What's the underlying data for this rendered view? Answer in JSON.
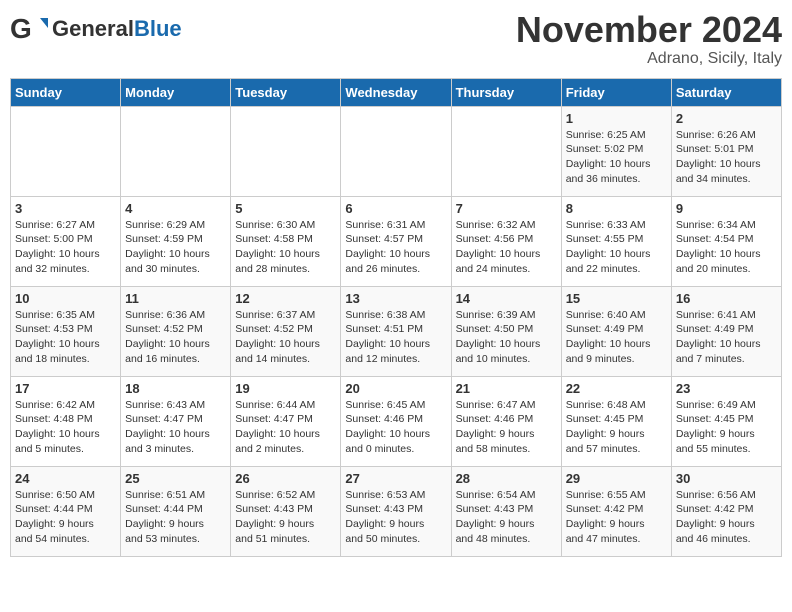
{
  "header": {
    "logo_general": "General",
    "logo_blue": "Blue",
    "month_title": "November 2024",
    "location": "Adrano, Sicily, Italy"
  },
  "weekdays": [
    "Sunday",
    "Monday",
    "Tuesday",
    "Wednesday",
    "Thursday",
    "Friday",
    "Saturday"
  ],
  "weeks": [
    [
      {
        "day": "",
        "info": ""
      },
      {
        "day": "",
        "info": ""
      },
      {
        "day": "",
        "info": ""
      },
      {
        "day": "",
        "info": ""
      },
      {
        "day": "",
        "info": ""
      },
      {
        "day": "1",
        "info": "Sunrise: 6:25 AM\nSunset: 5:02 PM\nDaylight: 10 hours\nand 36 minutes."
      },
      {
        "day": "2",
        "info": "Sunrise: 6:26 AM\nSunset: 5:01 PM\nDaylight: 10 hours\nand 34 minutes."
      }
    ],
    [
      {
        "day": "3",
        "info": "Sunrise: 6:27 AM\nSunset: 5:00 PM\nDaylight: 10 hours\nand 32 minutes."
      },
      {
        "day": "4",
        "info": "Sunrise: 6:29 AM\nSunset: 4:59 PM\nDaylight: 10 hours\nand 30 minutes."
      },
      {
        "day": "5",
        "info": "Sunrise: 6:30 AM\nSunset: 4:58 PM\nDaylight: 10 hours\nand 28 minutes."
      },
      {
        "day": "6",
        "info": "Sunrise: 6:31 AM\nSunset: 4:57 PM\nDaylight: 10 hours\nand 26 minutes."
      },
      {
        "day": "7",
        "info": "Sunrise: 6:32 AM\nSunset: 4:56 PM\nDaylight: 10 hours\nand 24 minutes."
      },
      {
        "day": "8",
        "info": "Sunrise: 6:33 AM\nSunset: 4:55 PM\nDaylight: 10 hours\nand 22 minutes."
      },
      {
        "day": "9",
        "info": "Sunrise: 6:34 AM\nSunset: 4:54 PM\nDaylight: 10 hours\nand 20 minutes."
      }
    ],
    [
      {
        "day": "10",
        "info": "Sunrise: 6:35 AM\nSunset: 4:53 PM\nDaylight: 10 hours\nand 18 minutes."
      },
      {
        "day": "11",
        "info": "Sunrise: 6:36 AM\nSunset: 4:52 PM\nDaylight: 10 hours\nand 16 minutes."
      },
      {
        "day": "12",
        "info": "Sunrise: 6:37 AM\nSunset: 4:52 PM\nDaylight: 10 hours\nand 14 minutes."
      },
      {
        "day": "13",
        "info": "Sunrise: 6:38 AM\nSunset: 4:51 PM\nDaylight: 10 hours\nand 12 minutes."
      },
      {
        "day": "14",
        "info": "Sunrise: 6:39 AM\nSunset: 4:50 PM\nDaylight: 10 hours\nand 10 minutes."
      },
      {
        "day": "15",
        "info": "Sunrise: 6:40 AM\nSunset: 4:49 PM\nDaylight: 10 hours\nand 9 minutes."
      },
      {
        "day": "16",
        "info": "Sunrise: 6:41 AM\nSunset: 4:49 PM\nDaylight: 10 hours\nand 7 minutes."
      }
    ],
    [
      {
        "day": "17",
        "info": "Sunrise: 6:42 AM\nSunset: 4:48 PM\nDaylight: 10 hours\nand 5 minutes."
      },
      {
        "day": "18",
        "info": "Sunrise: 6:43 AM\nSunset: 4:47 PM\nDaylight: 10 hours\nand 3 minutes."
      },
      {
        "day": "19",
        "info": "Sunrise: 6:44 AM\nSunset: 4:47 PM\nDaylight: 10 hours\nand 2 minutes."
      },
      {
        "day": "20",
        "info": "Sunrise: 6:45 AM\nSunset: 4:46 PM\nDaylight: 10 hours\nand 0 minutes."
      },
      {
        "day": "21",
        "info": "Sunrise: 6:47 AM\nSunset: 4:46 PM\nDaylight: 9 hours\nand 58 minutes."
      },
      {
        "day": "22",
        "info": "Sunrise: 6:48 AM\nSunset: 4:45 PM\nDaylight: 9 hours\nand 57 minutes."
      },
      {
        "day": "23",
        "info": "Sunrise: 6:49 AM\nSunset: 4:45 PM\nDaylight: 9 hours\nand 55 minutes."
      }
    ],
    [
      {
        "day": "24",
        "info": "Sunrise: 6:50 AM\nSunset: 4:44 PM\nDaylight: 9 hours\nand 54 minutes."
      },
      {
        "day": "25",
        "info": "Sunrise: 6:51 AM\nSunset: 4:44 PM\nDaylight: 9 hours\nand 53 minutes."
      },
      {
        "day": "26",
        "info": "Sunrise: 6:52 AM\nSunset: 4:43 PM\nDaylight: 9 hours\nand 51 minutes."
      },
      {
        "day": "27",
        "info": "Sunrise: 6:53 AM\nSunset: 4:43 PM\nDaylight: 9 hours\nand 50 minutes."
      },
      {
        "day": "28",
        "info": "Sunrise: 6:54 AM\nSunset: 4:43 PM\nDaylight: 9 hours\nand 48 minutes."
      },
      {
        "day": "29",
        "info": "Sunrise: 6:55 AM\nSunset: 4:42 PM\nDaylight: 9 hours\nand 47 minutes."
      },
      {
        "day": "30",
        "info": "Sunrise: 6:56 AM\nSunset: 4:42 PM\nDaylight: 9 hours\nand 46 minutes."
      }
    ]
  ]
}
